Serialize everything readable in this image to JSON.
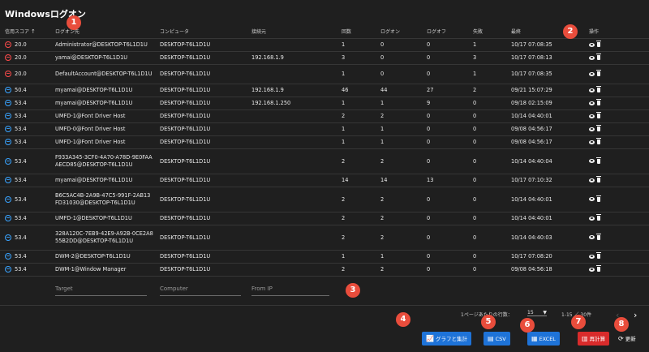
{
  "title": "Windowsログオン",
  "columns": {
    "score": "信用スコア",
    "account": "ログオン先",
    "computer": "コンピュータ",
    "from": "接続元",
    "count": "回数",
    "logon": "ログオン",
    "logoff": "ログオフ",
    "fail": "失敗",
    "last": "最終",
    "ops": "操作"
  },
  "rows": [
    {
      "status": "bad",
      "score": "20.0",
      "account": "Administrator@DESKTOP-T6L1D1U",
      "computer": "DESKTOP-T6L1D1U",
      "from": "",
      "count": "1",
      "logon": "0",
      "logoff": "0",
      "fail": "1",
      "last": "10/17 07:08:35"
    },
    {
      "status": "bad",
      "score": "20.0",
      "account": "yamai@DESKTOP-T6L1D1U",
      "computer": "DESKTOP-T6L1D1U",
      "from": "192.168.1.9",
      "count": "3",
      "logon": "0",
      "logoff": "0",
      "fail": "3",
      "last": "10/17 07:08:13"
    },
    {
      "status": "bad",
      "score": "20.0",
      "account": "DefaultAccount@DESKTOP-T6L1D1U",
      "computer": "DESKTOP-T6L1D1U",
      "from": "",
      "count": "1",
      "logon": "0",
      "logoff": "0",
      "fail": "1",
      "last": "10/17 07:08:35"
    },
    {
      "status": "good",
      "score": "50.4",
      "account": "myamai@DESKTOP-T6L1D1U",
      "computer": "DESKTOP-T6L1D1U",
      "from": "192.168.1.9",
      "count": "46",
      "logon": "44",
      "logoff": "27",
      "fail": "2",
      "last": "09/21 15:07:29"
    },
    {
      "status": "good",
      "score": "53.4",
      "account": "myamai@DESKTOP-T6L1D1U",
      "computer": "DESKTOP-T6L1D1U",
      "from": "192.168.1.250",
      "count": "1",
      "logon": "1",
      "logoff": "9",
      "fail": "0",
      "last": "09/18 02:15:09"
    },
    {
      "status": "good",
      "score": "53.4",
      "account": "UMFD-1@Font Driver Host",
      "computer": "DESKTOP-T6L1D1U",
      "from": "",
      "count": "2",
      "logon": "2",
      "logoff": "0",
      "fail": "0",
      "last": "10/14 04:40:01"
    },
    {
      "status": "good",
      "score": "53.4",
      "account": "UMFD-0@Font Driver Host",
      "computer": "DESKTOP-T6L1D1U",
      "from": "",
      "count": "1",
      "logon": "1",
      "logoff": "0",
      "fail": "0",
      "last": "09/08 04:56:17"
    },
    {
      "status": "good",
      "score": "53.4",
      "account": "UMFD-1@Font Driver Host",
      "computer": "DESKTOP-T6L1D1U",
      "from": "",
      "count": "1",
      "logon": "1",
      "logoff": "0",
      "fail": "0",
      "last": "09/08 04:56:17"
    },
    {
      "status": "good",
      "score": "53.4",
      "account": "F933A345-3CF0-4A70-A78D-9E0FAAAECD85@DESKTOP-T6L1D1U",
      "computer": "DESKTOP-T6L1D1U",
      "from": "",
      "count": "2",
      "logon": "2",
      "logoff": "0",
      "fail": "0",
      "last": "10/14 04:40:04"
    },
    {
      "status": "good",
      "score": "53.4",
      "account": "myamai@DESKTOP-T6L1D1U",
      "computer": "DESKTOP-T6L1D1U",
      "from": "",
      "count": "14",
      "logon": "14",
      "logoff": "13",
      "fail": "0",
      "last": "10/17 07:10:32"
    },
    {
      "status": "good",
      "score": "53.4",
      "account": "B6C5AC4B-2A9B-47C5-991F-2AB13FD31030@DESKTOP-T6L1D1U",
      "computer": "DESKTOP-T6L1D1U",
      "from": "",
      "count": "2",
      "logon": "2",
      "logoff": "0",
      "fail": "0",
      "last": "10/14 04:40:01"
    },
    {
      "status": "good",
      "score": "53.4",
      "account": "UMFD-1@DESKTOP-T6L1D1U",
      "computer": "DESKTOP-T6L1D1U",
      "from": "",
      "count": "2",
      "logon": "2",
      "logoff": "0",
      "fail": "0",
      "last": "10/14 04:40:01"
    },
    {
      "status": "good",
      "score": "53.4",
      "account": "328A120C-7EB9-42E9-A92B-0CE2A855B2DD@DESKTOP-T6L1D1U",
      "computer": "DESKTOP-T6L1D1U",
      "from": "",
      "count": "2",
      "logon": "2",
      "logoff": "0",
      "fail": "0",
      "last": "10/14 04:40:03"
    },
    {
      "status": "good",
      "score": "53.4",
      "account": "DWM-2@DESKTOP-T6L1D1U",
      "computer": "DESKTOP-T6L1D1U",
      "from": "",
      "count": "1",
      "logon": "1",
      "logoff": "0",
      "fail": "0",
      "last": "10/17 07:08:20"
    },
    {
      "status": "good",
      "score": "53.4",
      "account": "DWM-1@Window Manager",
      "computer": "DESKTOP-T6L1D1U",
      "from": "",
      "count": "2",
      "logon": "2",
      "logoff": "0",
      "fail": "0",
      "last": "09/08 04:56:18"
    }
  ],
  "filters": {
    "target": "Target",
    "computer": "Computer",
    "from": "From IP"
  },
  "pagination": {
    "rows_per_page_label": "1ページあたりの行数：",
    "rows_per_page": "15",
    "range": "1-15 ／ 30件"
  },
  "buttons": {
    "chart": "グラフと集計",
    "csv": "CSV",
    "excel": "EXCEL",
    "recalc": "再計算",
    "refresh": "更新"
  },
  "markers": [
    "1",
    "2",
    "3",
    "4",
    "5",
    "6",
    "7",
    "8"
  ],
  "colors": {
    "accent_blue": "#1e73d8",
    "danger_red": "#d92b2b",
    "marker": "#e94d3c",
    "bad_face": "#ff4b4b",
    "good_face": "#39a3ff"
  }
}
